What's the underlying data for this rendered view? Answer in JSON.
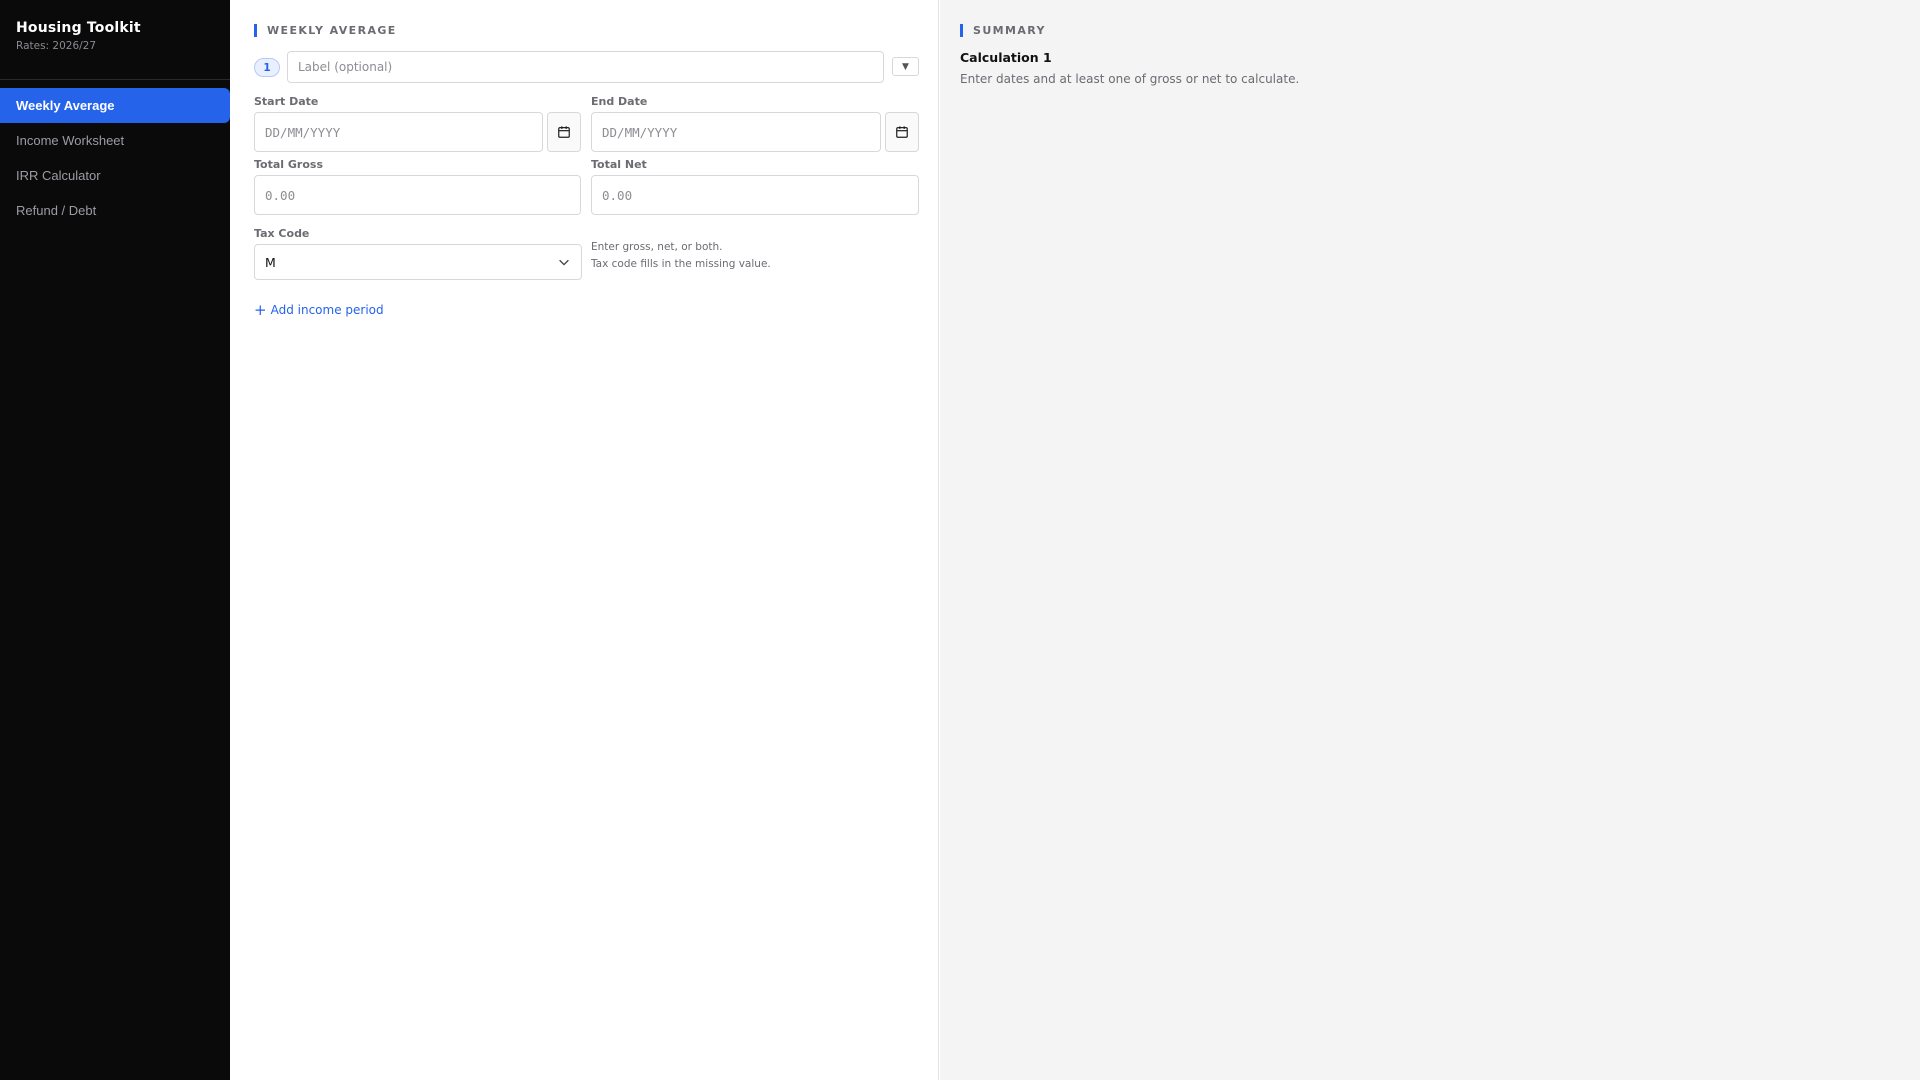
{
  "sidebar": {
    "title": "Housing Toolkit",
    "subtitle": "Rates: 2026/27",
    "items": [
      {
        "label": "Weekly Average",
        "active": true
      },
      {
        "label": "Income Worksheet",
        "active": false
      },
      {
        "label": "IRR Calculator",
        "active": false
      },
      {
        "label": "Refund / Debt",
        "active": false
      }
    ]
  },
  "main": {
    "section_title": "WEEKLY AVERAGE",
    "period": {
      "number": "1",
      "label_placeholder": "Label (optional)",
      "collapse_glyph": "▼",
      "start_date_label": "Start Date",
      "start_date_placeholder": "DD/MM/YYYY",
      "end_date_label": "End Date",
      "end_date_placeholder": "DD/MM/YYYY",
      "gross_label": "Total Gross",
      "gross_placeholder": "0.00",
      "net_label": "Total Net",
      "net_placeholder": "0.00",
      "tax_code_label": "Tax Code",
      "tax_code_value": "M",
      "hint_line1": "Enter gross, net, or both.",
      "hint_line2": "Tax code fills in the missing value."
    },
    "add_period_label": "Add income period",
    "add_period_glyph": "+"
  },
  "summary": {
    "title": "SUMMARY",
    "calc_name": "Calculation 1",
    "calc_message": "Enter dates and at least one of gross or net to calculate."
  },
  "colors": {
    "accent": "#2563eb",
    "sidebar_bg": "#0a0a0b",
    "summary_bg": "#f4f4f5"
  }
}
